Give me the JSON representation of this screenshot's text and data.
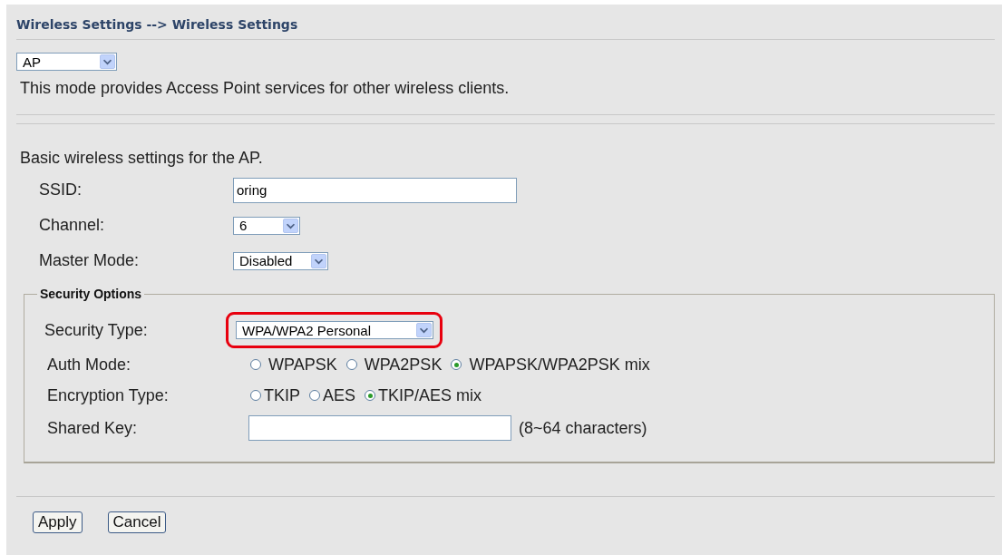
{
  "header": {
    "title": "Wireless Settings --> Wireless Settings"
  },
  "mode": {
    "value": "AP",
    "description": "This mode provides Access Point services for other wireless clients."
  },
  "basic": {
    "heading": "Basic wireless settings for the AP.",
    "fields": [
      {
        "kind": "text",
        "label": "SSID:",
        "value": "oring"
      },
      {
        "kind": "select",
        "label": "Channel:",
        "value": "6"
      },
      {
        "kind": "select",
        "label": "Master Mode:",
        "value": "Disabled"
      }
    ]
  },
  "security": {
    "legend": "Security Options",
    "type": {
      "label": "Security Type:",
      "value": "WPA/WPA2 Personal",
      "highlighted": true
    },
    "radio_groups": [
      {
        "label": "Auth Mode:",
        "options": [
          {
            "label": "WPAPSK",
            "selected": false
          },
          {
            "label": "WPA2PSK",
            "selected": false
          },
          {
            "label": "WPAPSK/WPA2PSK mix",
            "selected": true
          }
        ]
      },
      {
        "label": "Encryption Type:",
        "options": [
          {
            "label": "TKIP",
            "selected": false
          },
          {
            "label": "AES",
            "selected": false
          },
          {
            "label": "TKIP/AES mix",
            "selected": true
          }
        ]
      }
    ],
    "shared_key": {
      "label": "Shared Key:",
      "hint": "(8~64 characters)"
    }
  },
  "buttons": [
    "Apply",
    "Cancel"
  ]
}
